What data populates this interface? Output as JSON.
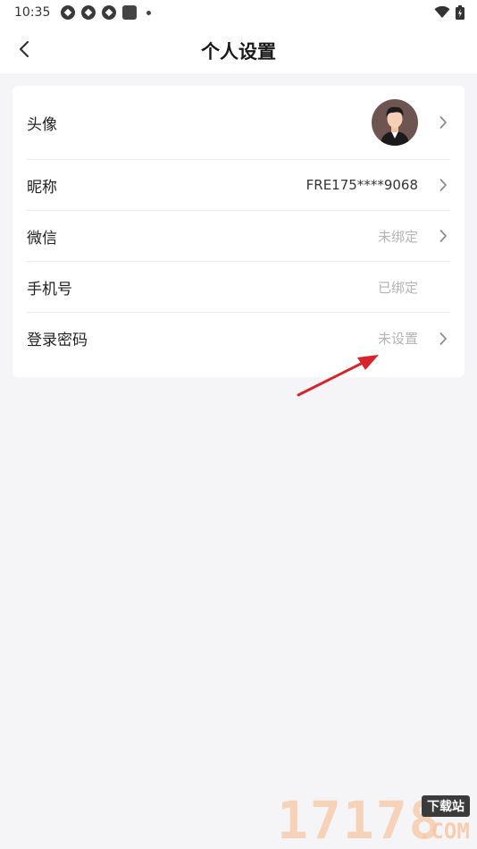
{
  "status_bar": {
    "time": "10:35",
    "icons": [
      "aperture-icon",
      "aperture-icon",
      "aperture-icon",
      "app-square-icon",
      "dot-icon",
      "wifi-icon",
      "battery-icon"
    ]
  },
  "header": {
    "back_icon": "chevron-left-icon",
    "title": "个人设置"
  },
  "settings": {
    "avatar": {
      "label": "头像"
    },
    "nickname": {
      "label": "昵称",
      "value": "FRE175****9068"
    },
    "wechat": {
      "label": "微信",
      "value": "未绑定"
    },
    "phone": {
      "label": "手机号",
      "value": "已绑定"
    },
    "password": {
      "label": "登录密码",
      "value": "未设置"
    }
  },
  "colors": {
    "page_background": "#f5f5f7",
    "card_background": "#ffffff",
    "muted_text": "#b3b3b3",
    "annotation_arrow": "#d9232a"
  },
  "watermark": {
    "digits": "17178",
    "tag": "下载站",
    "domain": ".COM"
  }
}
